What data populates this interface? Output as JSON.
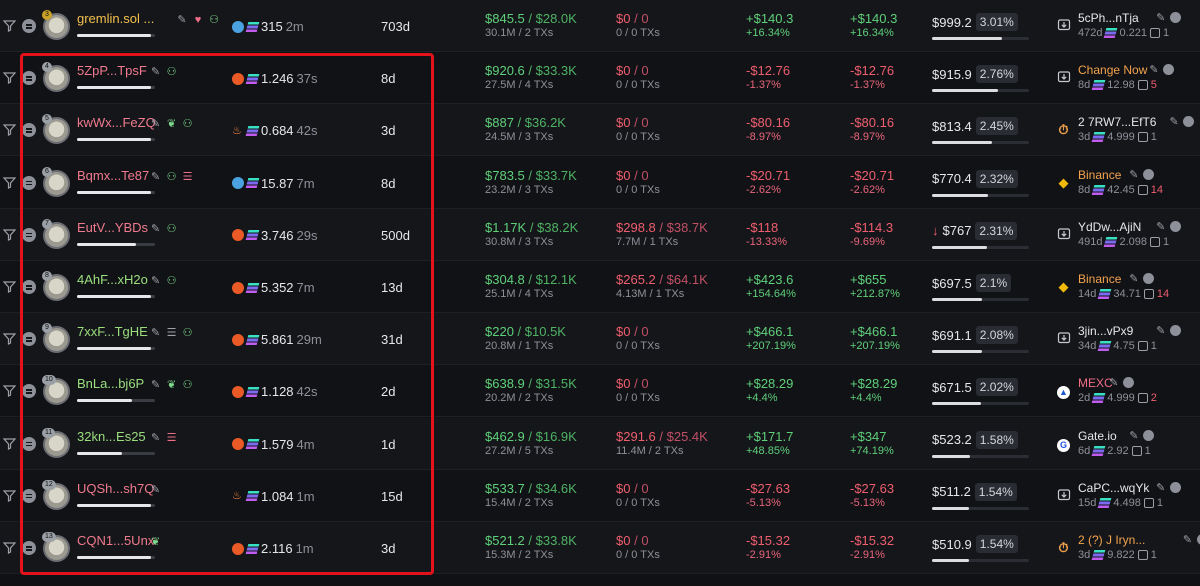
{
  "rows": [
    {
      "rank": "3",
      "wallet": "gremlin.sol ...",
      "wallet_color": "yellow",
      "icons": [
        "pencil-icon",
        "heart-icon",
        "user-plus-icon"
      ],
      "source": "dolphin",
      "balance": "315",
      "last": "2m",
      "age": "703d",
      "bought": "$845.5",
      "bought_total": "$28.0K",
      "bought_sub": "30.1M / 2 TXs",
      "sold": "$0",
      "sold_total": "0",
      "sold_sub": "0 / 0 TXs",
      "pnl": "+$140.3",
      "pnl_pct": "+16.34%",
      "upnl": "+$140.3",
      "upnl_pct": "+16.34%",
      "hold": "$999.2",
      "hold_pct": "3.01%",
      "hold_level": 0.72,
      "fund_name": "5cPh...nTja",
      "fund_icon": "arrow-in-icon",
      "fund_sub": "472d",
      "fund_bal": "0.221",
      "fund_txs": "1",
      "fund_txs_red": false
    },
    {
      "rank": "4",
      "wallet": "5ZpP...TpsF",
      "wallet_color": "pink",
      "icons": [
        "pencil-icon",
        "user-plus-icon"
      ],
      "source": "fire",
      "balance": "1.246",
      "last": "37s",
      "age": "8d",
      "bought": "$920.6",
      "bought_total": "$33.3K",
      "bought_sub": "27.5M / 4 TXs",
      "sold": "$0",
      "sold_total": "0",
      "sold_sub": "0 / 0 TXs",
      "pnl": "-$12.76",
      "pnl_pct": "-1.37%",
      "upnl": "-$12.76",
      "upnl_pct": "-1.37%",
      "hold": "$915.9",
      "hold_pct": "2.76%",
      "hold_level": 0.68,
      "fund_name": "Change Now",
      "fund_name_orange": true,
      "fund_icon": "arrow-in-icon",
      "fund_sub": "8d",
      "fund_bal": "12.98",
      "fund_txs": "5",
      "fund_txs_red": true
    },
    {
      "rank": "5",
      "wallet": "kwWx...FeZQ",
      "wallet_color": "pink",
      "icons": [
        "pencil-icon",
        "leaf-icon",
        "user-plus-icon"
      ],
      "source": "bonk",
      "balance": "0.684",
      "last": "42s",
      "age": "3d",
      "bought": "$887",
      "bought_total": "$36.2K",
      "bought_sub": "24.5M / 3 TXs",
      "sold": "$0",
      "sold_total": "0",
      "sold_sub": "0 / 0 TXs",
      "pnl": "-$80.16",
      "pnl_pct": "-8.97%",
      "upnl": "-$80.16",
      "upnl_pct": "-8.97%",
      "hold": "$813.4",
      "hold_pct": "2.45%",
      "hold_level": 0.62,
      "fund_name": "2 7RW7...EfT6",
      "fund_icon": "timer-icon",
      "fund_sub": "3d",
      "fund_bal": "4.999",
      "fund_txs": "1",
      "fund_txs_red": false
    },
    {
      "rank": "6",
      "wallet": "Bqmx...Te87",
      "wallet_color": "pink",
      "icons": [
        "pencil-icon",
        "user-plus-icon",
        "layers-icon"
      ],
      "source": "eye",
      "balance": "15.87",
      "last": "7m",
      "age": "8d",
      "bought": "$783.5",
      "bought_total": "$33.7K",
      "bought_sub": "23.2M / 3 TXs",
      "sold": "$0",
      "sold_total": "0",
      "sold_sub": "0 / 0 TXs",
      "pnl": "-$20.71",
      "pnl_pct": "-2.62%",
      "upnl": "-$20.71",
      "upnl_pct": "-2.62%",
      "hold": "$770.4",
      "hold_pct": "2.32%",
      "hold_level": 0.58,
      "fund_name": "Binance",
      "fund_name_orange": true,
      "fund_icon": "binance-icon",
      "fund_sub": "8d",
      "fund_bal": "42.45",
      "fund_txs": "14",
      "fund_txs_red": true
    },
    {
      "rank": "7",
      "wallet": "EutV...YBDs",
      "wallet_color": "pink",
      "icons": [
        "pencil-icon",
        "user-plus-icon"
      ],
      "source": "fire",
      "balance": "3.746",
      "last": "29s",
      "age": "500d",
      "bought": "$1.17K",
      "bought_total": "$38.2K",
      "bought_sub": "30.8M / 3 TXs",
      "sold": "$298.8",
      "sold_total": "$38.7K",
      "sold_sub": "7.7M / 1 TXs",
      "pnl": "-$118",
      "pnl_pct": "-13.33%",
      "upnl": "-$114.3",
      "upnl_pct": "-9.69%",
      "hold_arrow": "↓",
      "hold": "$767",
      "hold_pct": "2.31%",
      "hold_level": 0.57,
      "fund_name": "YdDw...AjiN",
      "fund_icon": "arrow-in-icon",
      "fund_sub": "491d",
      "fund_bal": "2.098",
      "fund_txs": "1",
      "fund_txs_red": false
    },
    {
      "rank": "8",
      "wallet": "4AhF...xH2o",
      "wallet_color": "green",
      "icons": [
        "pencil-icon",
        "user-plus-icon"
      ],
      "source": "fire",
      "balance": "5.352",
      "last": "7m",
      "age": "13d",
      "bought": "$304.8",
      "bought_total": "$12.1K",
      "bought_sub": "25.1M / 4 TXs",
      "sold": "$265.2",
      "sold_total": "$64.1K",
      "sold_sub": "4.13M / 1 TXs",
      "pnl": "+$423.6",
      "pnl_pct": "+154.64%",
      "upnl": "+$655",
      "upnl_pct": "+212.87%",
      "hold": "$697.5",
      "hold_pct": "2.1%",
      "hold_level": 0.52,
      "fund_name": "Binance",
      "fund_name_orange": true,
      "fund_icon": "binance-icon",
      "fund_sub": "14d",
      "fund_bal": "34.71",
      "fund_txs": "14",
      "fund_txs_red": true
    },
    {
      "rank": "9",
      "wallet": "7xxF...TgHE",
      "wallet_color": "green",
      "icons": [
        "pencil-icon",
        "list-icon",
        "user-plus-icon"
      ],
      "source": "fire",
      "balance": "5.861",
      "last": "29m",
      "age": "31d",
      "bought": "$220",
      "bought_total": "$10.5K",
      "bought_sub": "20.8M / 1 TXs",
      "sold": "$0",
      "sold_total": "0",
      "sold_sub": "0 / 0 TXs",
      "pnl": "+$466.1",
      "pnl_pct": "+207.19%",
      "upnl": "+$466.1",
      "upnl_pct": "+207.19%",
      "hold": "$691.1",
      "hold_pct": "2.08%",
      "hold_level": 0.52,
      "fund_name": "3jin...vPx9",
      "fund_icon": "arrow-in-icon",
      "fund_sub": "34d",
      "fund_bal": "4.75",
      "fund_txs": "1",
      "fund_txs_red": false
    },
    {
      "rank": "10",
      "wallet": "BnLa...bj6P",
      "wallet_color": "green",
      "icons": [
        "pencil-icon",
        "leaf-icon",
        "user-plus-icon"
      ],
      "source": "fire",
      "balance": "1.128",
      "last": "42s",
      "age": "2d",
      "bought": "$638.9",
      "bought_total": "$31.5K",
      "bought_sub": "20.2M / 2 TXs",
      "sold": "$0",
      "sold_total": "0",
      "sold_sub": "0 / 0 TXs",
      "pnl": "+$28.29",
      "pnl_pct": "+4.4%",
      "upnl": "+$28.29",
      "upnl_pct": "+4.4%",
      "hold": "$671.5",
      "hold_pct": "2.02%",
      "hold_level": 0.5,
      "fund_name": "MEXC",
      "fund_name_pink": true,
      "fund_icon": "mexc-icon",
      "fund_sub": "2d",
      "fund_bal": "4.999",
      "fund_txs": "2",
      "fund_txs_red": true
    },
    {
      "rank": "11",
      "wallet": "32kn...Es25",
      "wallet_color": "green",
      "icons": [
        "pencil-icon",
        "layers-icon"
      ],
      "source": "fire",
      "balance": "1.579",
      "last": "4m",
      "age": "1d",
      "bought": "$462.9",
      "bought_total": "$16.9K",
      "bought_sub": "27.2M / 5 TXs",
      "sold": "$291.6",
      "sold_total": "$25.4K",
      "sold_sub": "11.4M / 2 TXs",
      "pnl": "+$171.7",
      "pnl_pct": "+48.85%",
      "upnl": "+$347",
      "upnl_pct": "+74.19%",
      "hold": "$523.2",
      "hold_pct": "1.58%",
      "hold_level": 0.39,
      "fund_name": "Gate.io",
      "fund_icon": "gateio-icon",
      "fund_sub": "6d",
      "fund_bal": "2.92",
      "fund_txs": "1",
      "fund_txs_red": false
    },
    {
      "rank": "12",
      "wallet": "UQSh...sh7Q",
      "wallet_color": "pink",
      "icons": [
        "pencil-icon"
      ],
      "source": "bonk",
      "balance": "1.084",
      "last": "1m",
      "age": "15d",
      "bought": "$533.7",
      "bought_total": "$34.6K",
      "bought_sub": "15.4M / 2 TXs",
      "sold": "$0",
      "sold_total": "0",
      "sold_sub": "0 / 0 TXs",
      "pnl": "-$27.63",
      "pnl_pct": "-5.13%",
      "upnl": "-$27.63",
      "upnl_pct": "-5.13%",
      "hold": "$511.2",
      "hold_pct": "1.54%",
      "hold_level": 0.38,
      "fund_name": "CaPC...wqYk",
      "fund_icon": "arrow-in-icon",
      "fund_sub": "15d",
      "fund_bal": "4.498",
      "fund_txs": "1",
      "fund_txs_red": false
    },
    {
      "rank": "13",
      "wallet": "CQN1...5Unx",
      "wallet_color": "pink",
      "icons": [
        "leaf-icon"
      ],
      "source": "fire",
      "balance": "2.116",
      "last": "1m",
      "age": "3d",
      "bought": "$521.2",
      "bought_total": "$33.8K",
      "bought_sub": "15.3M / 2 TXs",
      "sold": "$0",
      "sold_total": "0",
      "sold_sub": "0 / 0 TXs",
      "pnl": "-$15.32",
      "pnl_pct": "-2.91%",
      "upnl": "-$15.32",
      "upnl_pct": "-2.91%",
      "hold": "$510.9",
      "hold_pct": "1.54%",
      "hold_level": 0.38,
      "fund_name": "2 (?) J Iryn...",
      "fund_name_orange": true,
      "fund_icon": "timer-icon",
      "fund_sub": "3d",
      "fund_bal": "9.822",
      "fund_txs": "1",
      "fund_txs_red": false
    }
  ],
  "wallet_bar_levels": [
    0.95,
    0.95,
    0.95,
    0.95,
    0.75,
    0.95,
    0.95,
    0.7,
    0.58,
    0.95,
    0.95
  ],
  "colors": {
    "accent_highlight": "#e3121b",
    "positive": "#5fd07a",
    "negative": "#ef5e6e"
  }
}
